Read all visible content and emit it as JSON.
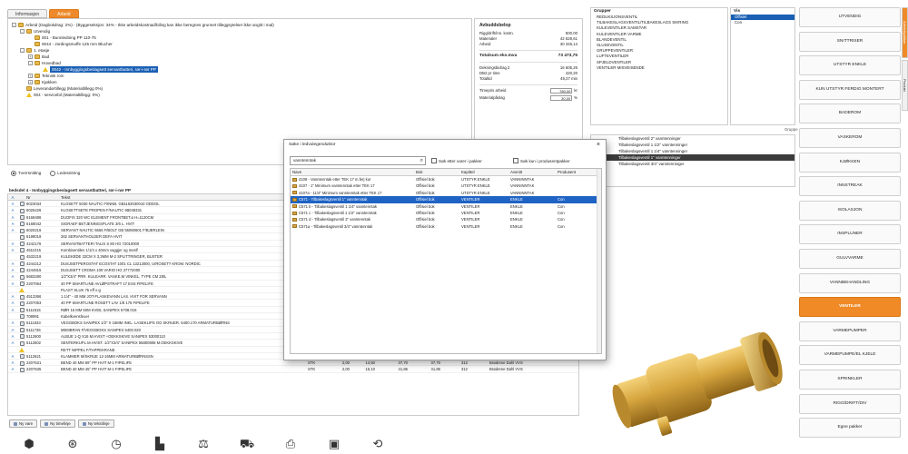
{
  "tabs": [
    "Informasjon",
    "Arbeid"
  ],
  "tree": [
    {
      "indent": 0,
      "tw": "-",
      "icon": "folder",
      "text": "Arbeid (Dagbokdrag: 2%) - (Byggeseksjon: 34% - Ikke arbeidskostnad/biling kan ikke beregnes grunnet tilleggsytelser ikke angitt i mal)"
    },
    {
      "indent": 1,
      "tw": "-",
      "icon": "folder",
      "text": "Utvendig"
    },
    {
      "indent": 2,
      "tw": "",
      "icon": "folder",
      "text": "001 - Bunnledning PP 110-75"
    },
    {
      "indent": 2,
      "tw": "",
      "icon": "folder",
      "text": "0044 - Jordingsmuffe 125 mm Blucher"
    },
    {
      "indent": 1,
      "tw": "-",
      "icon": "folder",
      "text": "1. etasje"
    },
    {
      "indent": 2,
      "tw": "+",
      "icon": "folder",
      "text": "Bad"
    },
    {
      "indent": 2,
      "tw": "-",
      "icon": "folder",
      "text": "Hovedbad"
    },
    {
      "indent": 3,
      "tw": "",
      "icon": "warn",
      "text": "0042 - Innbyggingsbeslagsett servantbatteri, rør-i-rør PP",
      "sel": true
    },
    {
      "indent": 2,
      "tw": "+",
      "icon": "folder",
      "text": "Teknisk rom"
    },
    {
      "indent": 2,
      "tw": "+",
      "icon": "folder",
      "text": "Kjøkken"
    },
    {
      "indent": 1,
      "tw": "",
      "icon": "folder",
      "text": "Leverandørtillegg (Materialtillegg 0%)"
    },
    {
      "indent": 1,
      "tw": "",
      "icon": "warn",
      "text": "004 - servicebil (Materialtillegg: 0%)"
    }
  ],
  "summary": {
    "title": "Avbuddsbelop",
    "rows": [
      {
        "label": "Rigg/drift/inn. kostn.",
        "value": "500,00"
      },
      {
        "label": "Materialer",
        "value": "42 628,61"
      },
      {
        "label": "Arbeid",
        "value": "30 345,14"
      }
    ],
    "total": {
      "label": "Totalsum eks.mva",
      "value": "73 473,75"
    },
    "rows2": [
      {
        "label": "Dekningsbidrag 2",
        "value": "16 605,26"
      },
      {
        "label": "DB2 pr time",
        "value": "420,20"
      },
      {
        "label": "Totaltid",
        "value": "49,27 min"
      }
    ],
    "timepris_label": "Timepris arbeid",
    "timepris_value": "780,00",
    "timepris_unit": "kr",
    "materialp_label": "Materialpåslag",
    "materialp_value": "30,00",
    "materialp_unit": "%"
  },
  "radios": {
    "opt1": "Tverrsnitting",
    "opt2": "Ledesnitring"
  },
  "path_line": "bedsdel 4 - Innbyggingsbeslagsett servantbatteri, rør-i-rør PP",
  "table": {
    "headers": [
      "A",
      "",
      "Nr",
      "Tekst",
      "",
      "",
      "",
      "",
      "",
      "",
      "",
      ""
    ],
    "rows": [
      {
        "a": "A",
        "i": "g",
        "nr": "6023034",
        "t": "KLOSETT 5030 NAUTIC F/INNB. GB1153030010 ODDOL"
      },
      {
        "a": "A",
        "i": "g",
        "nr": "6025426",
        "t": "KLOSETTSETE PROPEN F/NAUTIC 98049331"
      },
      {
        "a": "A",
        "i": "g",
        "nr": "6168486",
        "t": "DUOFIX 320 WC ELEMENT FRONTBET.ø H=1120CM"
      },
      {
        "a": "A",
        "i": "g",
        "nr": "6168042",
        "t": "SIGRAEF BETJENINGSPLATE 3/6 L. HVIT"
      },
      {
        "a": "A",
        "i": "g",
        "nr": "6020216",
        "t": "SERVANT NAUTIC 5556 F/BOLT GB 55060601 F/BJERLEIN"
      },
      {
        "a": "",
        "i": "g",
        "nr": "6198019",
        "t": "262 SERVANTHOLDER DEFA HVIT"
      },
      {
        "a": "A",
        "i": "g",
        "nr": "4242176",
        "t": "SERVANTBATTERI TALIS S 80 HG 72010000"
      },
      {
        "a": "A",
        "i": "g",
        "nr": "4511015",
        "t": "Kombiventilen 1/1/4 x 40mm vaggjer og meslf"
      },
      {
        "a": "",
        "i": "g",
        "nr": "4532219",
        "t": "KULEKEDE 32CM X 3,3MM M-2 SPLITTRINGER, BUSTER"
      },
      {
        "a": "A",
        "i": "g",
        "nr": "4244212",
        "t": "DUSJSETPEROSTAT ECOSTAT 1001 CL 13213000, U/ROSETT KROM. NORDIC"
      },
      {
        "a": "A",
        "i": "g",
        "nr": "4244816",
        "t": "DUSJSETT CROMA 100 VARIO HG 27772000"
      },
      {
        "a": "A",
        "i": "g",
        "nr": "5683280",
        "t": "1/2\"X3/4\" PRR. KULEARR. VASKE.M VINKEL, TYPE CM 28/L"
      },
      {
        "a": "A",
        "i": "g",
        "nr": "2207064",
        "t": "40 PP SMARTLINE AVLØPSTRAFT 17 ESS FIPELIFE"
      },
      {
        "a": "",
        "i": "w",
        "nr": "",
        "t": "PLAST SLUK 75 eff x-g"
      },
      {
        "a": "A",
        "i": "g",
        "nr": "4513366",
        "t": "1.1/4\" - 40 MM JOT-FLASKEVANN LAS. HVIT FOR SERVANN"
      },
      {
        "a": "A",
        "i": "g",
        "nr": "2207063",
        "t": "40 PP SMARTLINE ROSETT LAV 1/8 176 FIPELIFE"
      },
      {
        "a": "A",
        "i": "g",
        "nr": "5111515",
        "t": "RØR 16 MM 50M KVEIL SANIPEX 5708.016"
      },
      {
        "a": "",
        "i": "g",
        "nr": "708991",
        "t": "Kabelkvensfeuer"
      },
      {
        "a": "A",
        "i": "g",
        "nr": "5111633",
        "t": "VEGGBOKS SANIPEX 1/2\" X 16MM INKL. LASEKLIPS OG SKRUER. 5400.170 ARMATURBØRNS"
      },
      {
        "a": "A",
        "i": "g",
        "nr": "5111736",
        "t": "MEMBRAN F/VEGGBOKS SANIPEX 5400.020",
        "e": "STK",
        "q": "5,00",
        "p1": "50,69",
        "p2": "329,50",
        "p3": "329,50",
        "p4": "312",
        "no": "",
        "s": "Brødrene Dahl VVS"
      },
      {
        "a": "A",
        "i": "g",
        "nr": "5112600",
        "t": "ALBUE 1-Q X16 M.HVIST +OEKKSKIVE SANIPEX 53000110",
        "e": "STK",
        "q": "2,00",
        "p1": "107,76",
        "p2": "410,18",
        "p3": "410,18",
        "p4": "315",
        "no": "",
        "s": "Brødrene Dahl VVS"
      },
      {
        "a": "A",
        "i": "g",
        "nr": "5112602",
        "t": "SENTERKUPL.M.HVIST. 1/2\"X3/4\" SANIPEX 55800808 M.OEKKSKIVE",
        "e": "STK",
        "q": "2,00",
        "p1": "176,26",
        "p2": "458,28",
        "p3": "458,28",
        "p4": "315",
        "no": "",
        "s": "Brødrene Dahl VVS"
      },
      {
        "a": "",
        "i": "w",
        "nr": "",
        "t": "RETT NIPPEL F/TAPPEKRANE",
        "e": "STK",
        "q": "1,00",
        "p1": "0,00",
        "p2": "0,00",
        "p3": "0,00",
        "p4": "0",
        "no": "",
        "s": ""
      },
      {
        "a": "A",
        "i": "g",
        "nr": "5112621",
        "t": "KLAMMER M/SKRUE 12-16MM ARMATURBØRNSSN",
        "e": "STK",
        "q": "5,00",
        "p1": "7,59",
        "p2": "65,83",
        "p3": "65,83",
        "p4": "312",
        "no": "",
        "s": "Brødrene Dahl VVS"
      },
      {
        "a": "A",
        "i": "g",
        "nr": "2207631",
        "t": "BEND 40 MM 89° PP HVIT M-1 FIPELIFE",
        "e": "STK",
        "q": "2,00",
        "p1": "14,50",
        "p2": "37,70",
        "p3": "37,70",
        "p4": "312",
        "no": "",
        "s": "Brødrene Dahl VVS"
      },
      {
        "a": "A",
        "i": "g",
        "nr": "2207635",
        "t": "BEND 40 MM 45° PP HVIT M-1 FIPELIFE",
        "e": "STK",
        "q": "2,00",
        "p1": "16,10",
        "p2": "41,86",
        "p3": "41,86",
        "p4": "312",
        "no": "",
        "s": "Brødrene Dahl VVS"
      }
    ]
  },
  "bottom_buttons": [
    "Ny vare",
    "Ny timelinje",
    "Ny tekstlinje"
  ],
  "toolbar_icons": [
    "box-icon",
    "network-icon",
    "clock-icon",
    "chart-icon",
    "scale-icon",
    "cart-icon",
    "print-icon",
    "save-icon",
    "refresh-icon"
  ],
  "groups": {
    "title": "Grupper",
    "items": [
      "REDUKSJONSVENTIL",
      "TILBAKESLAGSVENTIL/TILBAKESLAGS SIKRING",
      "KULEVENTILER SAMSTAR",
      "KULEVENTILER VARME",
      "BLANDEVENTIL",
      "SLUSEVENTIL",
      "GRUPPEVENTILER",
      "LUFTEVENTILER",
      "SPJELDVENTILER",
      "VENTILER MISVEISENDE"
    ]
  },
  "vis": {
    "title": "Vis",
    "items": [
      "Offisiel",
      "Con"
    ]
  },
  "gruppe_label": "Gruppe",
  "secs": [
    {
      "text": "Tilbakeslagsventil 2\" vanntenninger",
      "sel": false
    },
    {
      "text": "Tilbakeslagsventil 1 1/2\" vanntenninger",
      "sel": false
    },
    {
      "text": "Tilbakeslagsventil 1 1/4\" vanntenninger",
      "sel": false
    },
    {
      "text": "Tilbakeslagsventil 1\" vanntenninger",
      "sel": true
    },
    {
      "text": "Tilbakeslagsventil 3/4\" vanntenninger",
      "sel": false
    }
  ],
  "categories": [
    "UTVENDIG",
    "SNITTRISER",
    "UTSTYR ENKLE",
    "KUN UTSTYR FERDIG MONTERT",
    "BADEROM",
    "VASKEROM",
    "KJØKKEN",
    "INNSTREAK",
    "ISOLASJON",
    "INSPLUNER",
    "GULVVARME",
    "VANNBEHANDLING",
    "VENTILER",
    "VARMEPUMPER",
    "VARMEPUMPE/EL KJELE",
    "SPRINKLER",
    "RIGG/DRIFT/DIV",
    "Egne pakker"
  ],
  "active_category": "VENTILER",
  "vtabs": [
    "Arbeidspakker",
    "Produkt"
  ],
  "dialog": {
    "title": "Søke i ledvulegenduktor",
    "search_value": "vanntenntak",
    "chk1": "Søk etter varer i pakker",
    "chk2": "Søk kun i produsentpakker",
    "headers": [
      "Navn",
      "Bok",
      "Kapittel",
      "Avsnitt",
      "Produsent"
    ],
    "rows": [
      {
        "n": "4108 - Vanntenntak etter TEK 17 m.ferj kur",
        "b": "Offisiel bok",
        "k": "UTSTYR ENKLE",
        "a": "VANNINNTAK",
        "p": ""
      },
      {
        "n": "4107 - 1\" Minimum vanntenntak etter TEK 17",
        "b": "Offisiel bok",
        "k": "UTSTYR ENKLE",
        "a": "VANNINNTAK",
        "p": ""
      },
      {
        "n": "4107a - 11/4\" Minimum vanntenntak etter TEK 17",
        "b": "Offisiel bok",
        "k": "UTSTYR ENKLE",
        "a": "VANNINNTAK",
        "p": ""
      },
      {
        "n": "C571 - Tilbakeslagsventil 1\" vanntenntak",
        "b": "Offisiel bok",
        "k": "VENTILER",
        "a": "ENKLE",
        "p": "Con",
        "sel": true
      },
      {
        "n": "C571 b - Tilbakeslagsventil 1 1/4\" vanntenntak",
        "b": "Offisiel bok",
        "k": "VENTILER",
        "a": "ENKLE",
        "p": "Con"
      },
      {
        "n": "C571 c - Tilbakeslagsventil 1 1/2\" vanntenntak",
        "b": "Offisiel bok",
        "k": "VENTILER",
        "a": "ENKLE",
        "p": "Con"
      },
      {
        "n": "C571 d - Tilbakeslagsventil 2\" vanntenntak",
        "b": "Offisiel bok",
        "k": "VENTILER",
        "a": "ENKLE",
        "p": "Con"
      },
      {
        "n": "C571a - Tilbakeslagsventil 3/4\" vanntenntak",
        "b": "Offisiel bok",
        "k": "VENTILER",
        "a": "ENKLE",
        "p": "Con"
      }
    ]
  },
  "colors": {
    "accent": "#ef8a26",
    "selection": "#1f63c4",
    "valve": "#c9962f"
  }
}
